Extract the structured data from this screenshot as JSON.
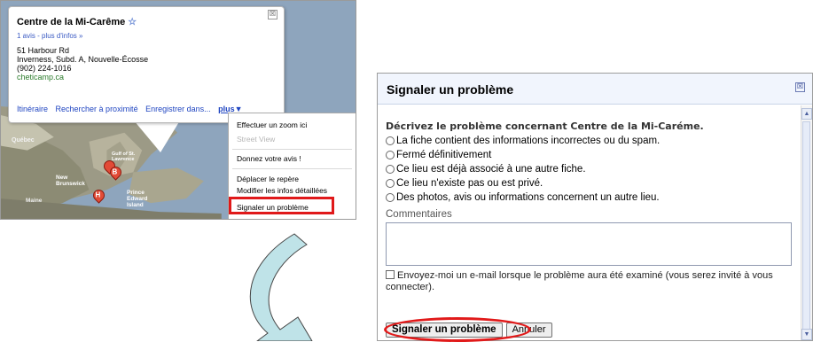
{
  "left_panel": {
    "bubble": {
      "title": "Centre de la Mi-Carême",
      "star_icon": "☆",
      "close_icon": "☒",
      "links": "1 avis - plus d'infos »",
      "address_line1": "51 Harbour Rd",
      "address_line2": "Inverness, Subd. A, Nouvelle-Écosse",
      "phone": "(902) 224-1016",
      "website": "cheticamp.ca",
      "actions": {
        "itineraire": "Itinéraire",
        "rechercher": "Rechercher à proximité",
        "enregistrer": "Enregistrer dans...",
        "plus": "plus▼"
      }
    },
    "menu": {
      "items": [
        "Effectuer un zoom ici",
        "Street View",
        "Donnez votre avis !",
        "Déplacer le repère",
        "Modifier les infos détaillées",
        "Signaler un problème"
      ]
    },
    "map_labels": {
      "quebec": "Québec",
      "new_brunswick": "New Brunswick",
      "maine": "Maine",
      "prince_edward": "Prince Edward Island",
      "gulf": "Gulf of St. Lawrence"
    },
    "pins": [
      "B",
      "H"
    ]
  },
  "dialog": {
    "title": "Signaler un problème",
    "close_icon": "☒",
    "prompt": "Décrivez le problème concernant Centre de la Mi-Caréme.",
    "options": [
      "La fiche contient des informations incorrectes ou du spam.",
      "Fermé définitivement",
      "Ce lieu est déjà associé à une autre fiche.",
      "Ce lieu n'existe pas ou est privé.",
      "Des photos, avis ou informations concernent un autre lieu."
    ],
    "comments_label": "Commentaires",
    "email_text": "Envoyez-moi un e-mail lorsque le problème aura été examiné (vous serez invité à vous connecter).",
    "submit_label": "Signaler un problème",
    "cancel_label": "Annuler"
  },
  "colors": {
    "highlight_red": "#e0191a",
    "arrow_fill": "#bfe3e8",
    "link_blue": "#1f45c1"
  }
}
